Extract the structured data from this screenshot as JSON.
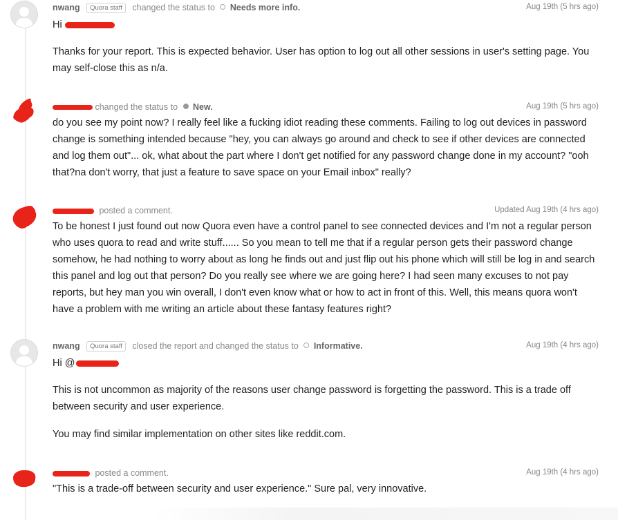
{
  "entries": [
    {
      "user": "nwang",
      "badge": "Quora staff",
      "action": "changed the status to",
      "status": "Needs more info.",
      "timestamp": "Aug 19th (5 hrs ago)",
      "greeting": "Hi",
      "paragraphs": [
        "Thanks for your report. This is expected behavior. User has option to log out all other sessions in user's setting page. You may self-close this as n/a."
      ]
    },
    {
      "action": "changed the status to",
      "status": "New.",
      "timestamp": "Aug 19th (5 hrs ago)",
      "paragraphs": [
        "do you see my point now? I really feel like a fucking idiot reading these comments. Failing to log out devices in password change is something intended because \"hey, you can always go around and check to see if other devices are connected and log them out\"... ok, what about the part where I don't get notified for any password change done in my account? \"ooh that?na don't worry, that just a feature to save space on your Email inbox\" really?"
      ]
    },
    {
      "action": "posted a comment.",
      "timestamp": "Updated Aug 19th (4 hrs ago)",
      "paragraphs": [
        "To be honest I just found out now Quora even have a control panel to see connected devices and I'm not a regular person who uses quora to read and write stuff...... So you mean to tell me that if a regular person gets their password change somehow, he had nothing to worry about as long he finds out and just flip out his phone which will still be log in and search this panel and log out that person? Do you really see where we are going here? I had seen many excuses to not pay reports, but hey man you win overall, I don't even know what or how to act in front of this. Well, this means quora won't have a problem with me writing an article about these fantasy features right?"
      ]
    },
    {
      "user": "nwang",
      "badge": "Quora staff",
      "action": "closed the report and changed the status to",
      "status": "Informative.",
      "timestamp": "Aug 19th (4 hrs ago)",
      "greeting": "Hi @",
      "paragraphs": [
        "This is not uncommon as majority of the reasons user change password is forgetting the password. This is a trade off between security and user experience.",
        "You may find similar implementation on other sites like reddit.com."
      ]
    },
    {
      "action": "posted a comment.",
      "timestamp": "Aug 19th (4 hrs ago)",
      "paragraphs": [
        "\"This is a trade-off between security and user experience.\" Sure pal, very innovative."
      ]
    }
  ]
}
